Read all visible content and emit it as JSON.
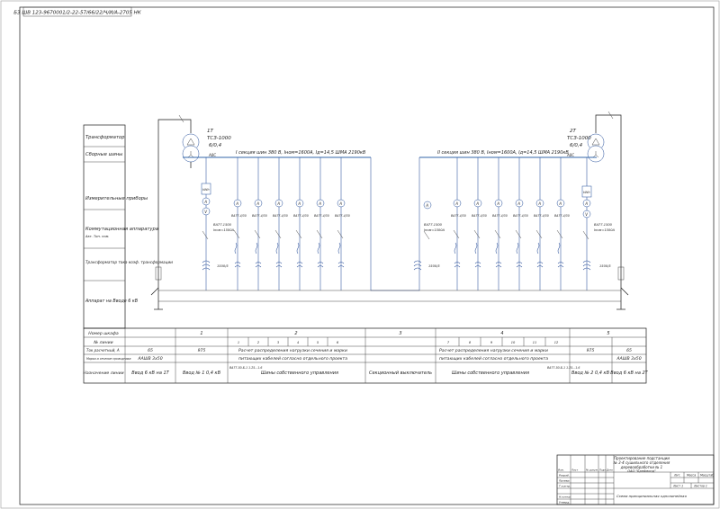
{
  "doc_code": "БЗ ШВ 123-9670001/2-22-57/66/22/Ч/И/А-2705 НК",
  "transformers": {
    "left": {
      "name": "1Т",
      "model": "ТСЗ-1000",
      "ratio": "6/0,4",
      "neutral": "А0С"
    },
    "right": {
      "name": "2Т",
      "model": "ТСЗ-1000",
      "ratio": "6/0,4",
      "neutral": "А0С"
    }
  },
  "bus_labels": {
    "left": "I секция шин 380 В, Iном=1600А, Iд=14,5 ШМА 2190кВ",
    "right": "II секция шин 380 В, Iном=1600А, Iд=14,5 ШМА 2190кВ"
  },
  "side_labels": {
    "transformer": "Трансформатор",
    "busbars": "Сборные шины",
    "meters": "Измерительные приборы",
    "switching": "Коммутационная аппаратура",
    "switching_sub": "Авт. Тип. ном.",
    "ct": "Трансформатор тока коэф. трансформации",
    "hv": "Аппарат на Вводе 6 кВ"
  },
  "devices": {
    "meter_a": "A",
    "meter_v": "V",
    "meter_kwh": "kWh",
    "breaker_in_type": "ВА77-1500",
    "breaker_in_rating": "Iном=1500А",
    "breaker_feeder": "ВА77-4/30",
    "ct_main": "1500/5",
    "ct_right": "1500/5"
  },
  "table": {
    "row_headers": [
      "Номер шкафа",
      "№ линии",
      "Ток расчетный, А",
      "Марка и сечение проводника",
      "Назначение линии"
    ],
    "cabinet_numbers": [
      "1",
      "2",
      "3",
      "4",
      "5"
    ],
    "line_numbers_left": [
      "1",
      "2",
      "3",
      "4",
      "5",
      "6"
    ],
    "line_numbers_right": [
      "7",
      "8",
      "9",
      "10",
      "11",
      "12"
    ],
    "currents": {
      "in_left_hv": "65",
      "in_left_lv": "975",
      "in_right_lv": "975",
      "in_right_hv": "65"
    },
    "feeder_note_1": "Расчет распределения нагрузки сечения и марки",
    "feeder_note_2": "питающих кабелей согласно отдельного проекта",
    "cable_left": "ААШВ 3х50",
    "cable_right": "ААШВ 3х50",
    "purpose": {
      "c0": "Ввод 6 кВ на 1Т",
      "c1": "Ввод № 1 0,4 кВ",
      "c2_note": "ВА77-50-Б-1 1.25...1.6",
      "c2": "Шины собственного управления",
      "c3": "Секционный выключатель",
      "c4": "Шины собственного управления",
      "c4_note": "ВА77-50-Б-1 1.25...1.6",
      "c5": "Ввод № 2 0,4 кВ",
      "c6": "Ввод 6 кВ на 2Т"
    }
  },
  "stamp": {
    "title_lines": [
      "Проектирование подстанции",
      "№ 3-4 сушильного отделения",
      "деревообработки № 1",
      "ОАО \"Бреймонд\""
    ],
    "col_headers": [
      "Лит.",
      "Масса",
      "Масштаб"
    ],
    "sheet": "Лист 1",
    "sheets": "Листов 1",
    "subtitle": "Схема принципиальная однолинейная",
    "roles": [
      "Разраб.",
      "Провер.",
      "Т.контр.",
      "Н.контр.",
      "Утверд."
    ],
    "left_cols": [
      "Изм.",
      "Лист",
      "№ докум.",
      "Подп.",
      "Дата"
    ]
  }
}
